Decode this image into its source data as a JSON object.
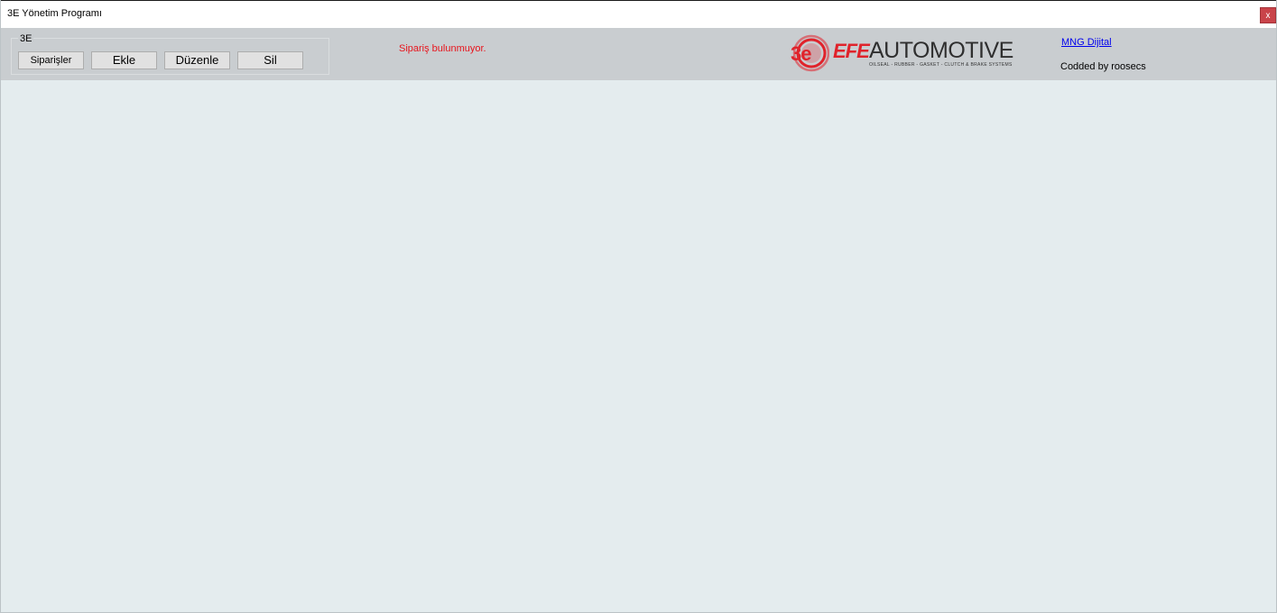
{
  "window": {
    "title": "3E Yönetim Programı",
    "close_label": "x"
  },
  "toolbar": {
    "group_label": "3E",
    "orders_label": "Siparişler",
    "add_label": "Ekle",
    "edit_label": "Düzenle",
    "delete_label": "Sil",
    "status_text": "Sipariş bulunmuyor.",
    "link_text": "MNG Dijital",
    "credit_text": "Codded by roosecs"
  },
  "logo": {
    "mark": "3e",
    "brand": "EFE",
    "name": "AUTOMOTIVE",
    "tagline": "OILSEAL - RUBBER - GASKET - CLUTCH & BRAKE SYSTEMS"
  },
  "colors": {
    "accent_red": "#e0232b",
    "status_red": "#e8141c",
    "toolbar_bg": "#c9cdd0",
    "content_bg": "#e4ecee",
    "close_bg": "#c9444a"
  }
}
